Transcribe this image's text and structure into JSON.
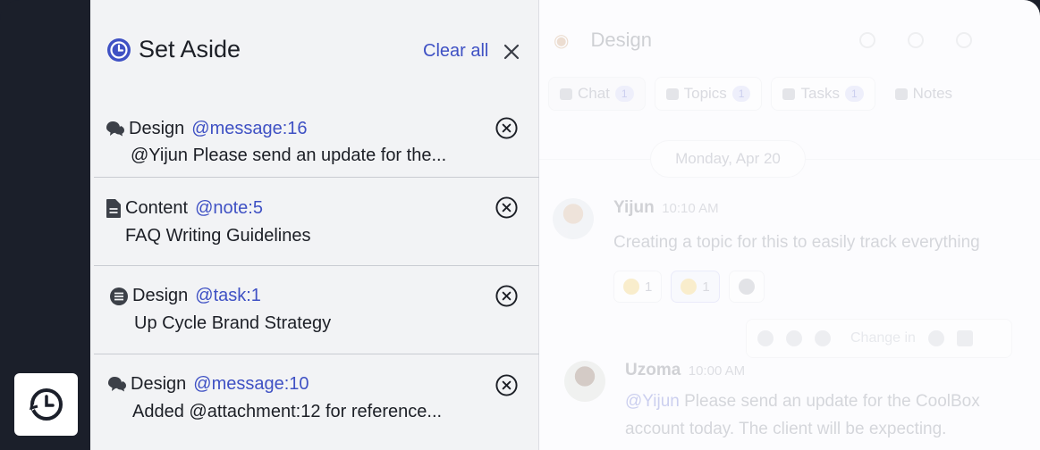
{
  "set_aside": {
    "title": "Set Aside",
    "clear_all": "Clear all",
    "items": [
      {
        "channel": "Design",
        "ref": "@message:16",
        "text": "@Yijun Please send an update for the...",
        "icon": "chat-bubbles-icon"
      },
      {
        "channel": "Content",
        "ref": "@note:5",
        "text": "FAQ Writing Guidelines",
        "icon": "document-icon"
      },
      {
        "channel": "Design",
        "ref": "@task:1",
        "text": "Up Cycle Brand Strategy",
        "icon": "task-list-icon"
      },
      {
        "channel": "Design",
        "ref": "@message:10",
        "text": "Added @attachment:12 for reference...",
        "icon": "chat-bubbles-icon"
      }
    ]
  },
  "channel": {
    "name": "Design",
    "tabs": [
      {
        "label": "Chat",
        "count": "1"
      },
      {
        "label": "Topics",
        "count": "1"
      },
      {
        "label": "Tasks",
        "count": "1"
      },
      {
        "label": "Notes",
        "count": ""
      }
    ],
    "date_divider": "Monday, Apr 20",
    "messages": [
      {
        "author": "Yijun",
        "time": "10:10 AM",
        "text": "Creating a topic for this to easily track everything",
        "reactions": [
          {
            "count": "1"
          },
          {
            "count": "1"
          }
        ]
      },
      {
        "author": "Uzoma",
        "time": "10:00 AM",
        "mention": "@Yijun",
        "text_line1": " Please send an update for the CoolBox",
        "text_line2": "account today. The client will be expecting."
      }
    ],
    "hover_bar_text": "Change in"
  },
  "colors": {
    "accent": "#3f51c4",
    "rail": "#1b1f2a",
    "panel_bg": "#f2f3f5"
  }
}
